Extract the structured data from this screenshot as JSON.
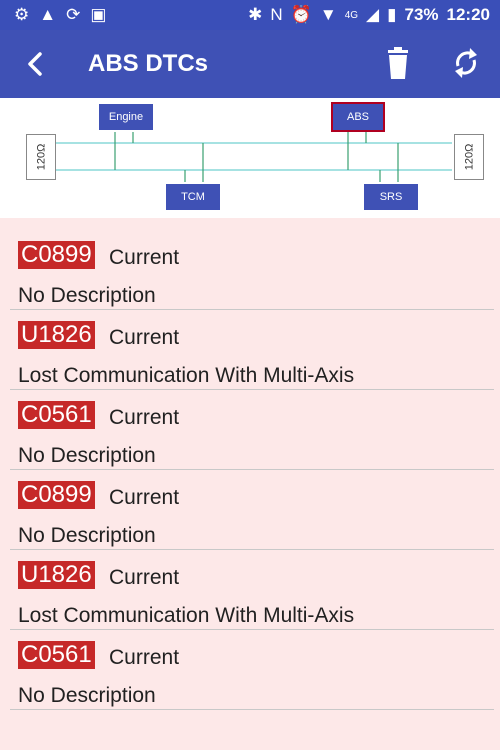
{
  "statusbar": {
    "network": "4G",
    "battery": "73%",
    "time": "12:20"
  },
  "appbar": {
    "title": "ABS DTCs",
    "back_icon": "back-arrow-icon",
    "trash_icon": "trash-icon",
    "refresh_icon": "refresh-icon"
  },
  "bus": {
    "nodes": [
      "Engine",
      "ABS",
      "TCM",
      "SRS"
    ],
    "terminator_left": "120Ω",
    "terminator_right": "120Ω",
    "line_color": "#88d8d8",
    "selected_color": "#b00020"
  },
  "dtcs": [
    {
      "code": "C0899",
      "status": "Current",
      "desc": "No Description"
    },
    {
      "code": "U1826",
      "status": "Current",
      "desc": "Lost Communication With Multi-Axis"
    },
    {
      "code": "C0561",
      "status": "Current",
      "desc": "No Description"
    },
    {
      "code": "C0899",
      "status": "Current",
      "desc": "No Description"
    },
    {
      "code": "U1826",
      "status": "Current",
      "desc": "Lost Communication With Multi-Axis"
    },
    {
      "code": "C0561",
      "status": "Current",
      "desc": "No Description"
    }
  ]
}
